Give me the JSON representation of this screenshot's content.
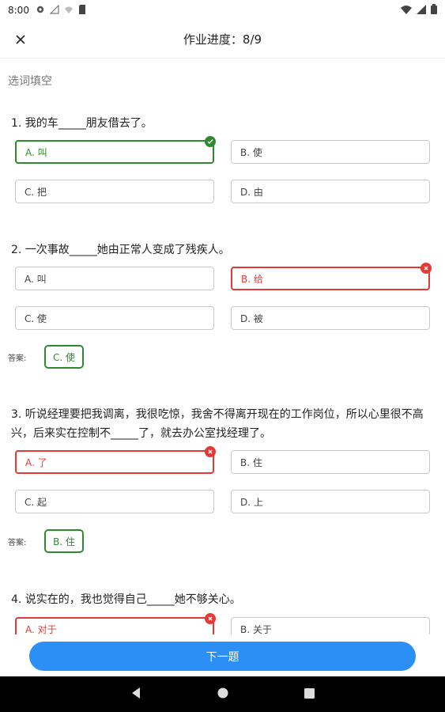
{
  "status_bar": {
    "time": "8:00",
    "left_icons": [
      "gear-icon",
      "signal-off-icon",
      "wifi-off-icon",
      "sd-card-icon"
    ],
    "right_icons": [
      "wifi-icon",
      "cell-signal-icon",
      "battery-icon"
    ]
  },
  "header": {
    "title": "作业进度：8/9",
    "close_icon": "close-icon"
  },
  "section_title": "选词填空",
  "questions": [
    {
      "text": "1. 我的车_____朋友借去了。",
      "options": [
        {
          "label": "A. 叫",
          "state": "correct"
        },
        {
          "label": "B. 使",
          "state": "normal"
        },
        {
          "label": "C. 把",
          "state": "normal"
        },
        {
          "label": "D. 由",
          "state": "normal"
        }
      ]
    },
    {
      "text": "2. 一次事故_____她由正常人变成了残疾人。",
      "options": [
        {
          "label": "A. 叫",
          "state": "normal"
        },
        {
          "label": "B. 给",
          "state": "wrong"
        },
        {
          "label": "C. 使",
          "state": "normal"
        },
        {
          "label": "D. 被",
          "state": "normal"
        }
      ],
      "answer_label": "答案:",
      "answer": "C. 使"
    },
    {
      "text": "3. 听说经理要把我调离，我很吃惊，我舍不得离开现在的工作岗位，所以心里很不高兴，后来实在控制不_____了，就去办公室找经理了。",
      "options": [
        {
          "label": "A. 了",
          "state": "wrong"
        },
        {
          "label": "B. 住",
          "state": "normal"
        },
        {
          "label": "C. 起",
          "state": "normal"
        },
        {
          "label": "D. 上",
          "state": "normal"
        }
      ],
      "answer_label": "答案:",
      "answer": "B. 住"
    },
    {
      "text": "4. 说实在的，我也觉得自己_____她不够关心。",
      "options": [
        {
          "label": "A. 对于",
          "state": "wrong"
        },
        {
          "label": "B. 关于",
          "state": "normal"
        }
      ]
    }
  ],
  "next_button": "下一题",
  "colors": {
    "correct": "#2f8a2f",
    "wrong": "#e53935",
    "primary": "#2b8ff5"
  },
  "nav_bar": [
    "back-icon",
    "home-icon",
    "recents-icon"
  ]
}
